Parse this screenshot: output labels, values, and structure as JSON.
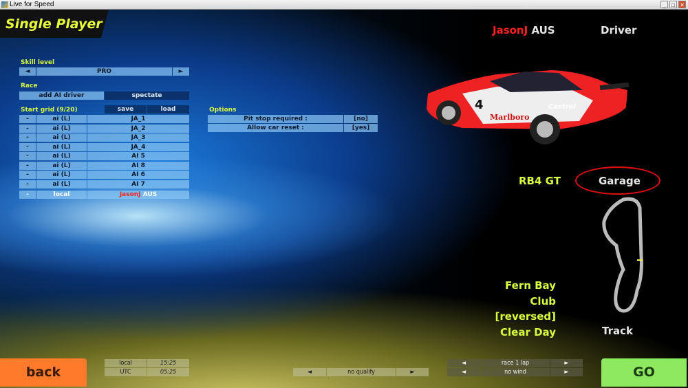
{
  "window": {
    "title": "Live for Speed",
    "min": "_",
    "max": "□",
    "close": "✕"
  },
  "header": {
    "title": "Single Player"
  },
  "skill": {
    "label": "Skill level",
    "value": "PRO",
    "prev": "◄",
    "next": "►"
  },
  "race": {
    "label": "Race",
    "add_ai": "add AI driver",
    "spectate": "spectate"
  },
  "grid": {
    "label": "Start grid (9/20)",
    "save": "save",
    "load": "load",
    "rows": [
      {
        "remove": "-",
        "type": "ai (L)",
        "name": "JA_1"
      },
      {
        "remove": "-",
        "type": "ai (L)",
        "name": "JA_2"
      },
      {
        "remove": "-",
        "type": "ai (L)",
        "name": "JA_3"
      },
      {
        "remove": "-",
        "type": "ai (L)",
        "name": "JA_4"
      },
      {
        "remove": "-",
        "type": "ai (L)",
        "name": "AI 5"
      },
      {
        "remove": "-",
        "type": "ai (L)",
        "name": "AI 8"
      },
      {
        "remove": "-",
        "type": "ai (L)",
        "name": "AI 6"
      },
      {
        "remove": "-",
        "type": "ai (L)",
        "name": "AI 7"
      }
    ],
    "local_row": {
      "remove": "-",
      "type": "local",
      "name": "JasonJ",
      "country": "AUS"
    }
  },
  "options": {
    "label": "Options",
    "items": [
      {
        "label": "Pit stop required :",
        "value": "[no]"
      },
      {
        "label": "Allow car reset :",
        "value": "[yes]"
      }
    ]
  },
  "driver": {
    "name": "JasonJ",
    "country": "AUS",
    "button": "Driver"
  },
  "car": {
    "name": "RB4 GT",
    "button": "Garage",
    "livery_number": "4",
    "livery_text": "Marlboro",
    "sponsor": "Castrol"
  },
  "track": {
    "name": "Fern Bay",
    "config": "Club",
    "direction": "[reversed]",
    "weather": "Clear Day",
    "button": "Track"
  },
  "bottom": {
    "back": "back",
    "go": "GO",
    "local_label": "local",
    "local_time": "15:25",
    "utc_label": "UTC",
    "utc_time": "05:25",
    "qualify": "no qualify",
    "race": "race 1 lap",
    "wind": "no wind",
    "prev": "◄",
    "next": "►"
  },
  "colors": {
    "accent": "#d8ff40",
    "back": "#ff7a2a",
    "go": "#8ee860",
    "highlight": "#ff2020"
  }
}
